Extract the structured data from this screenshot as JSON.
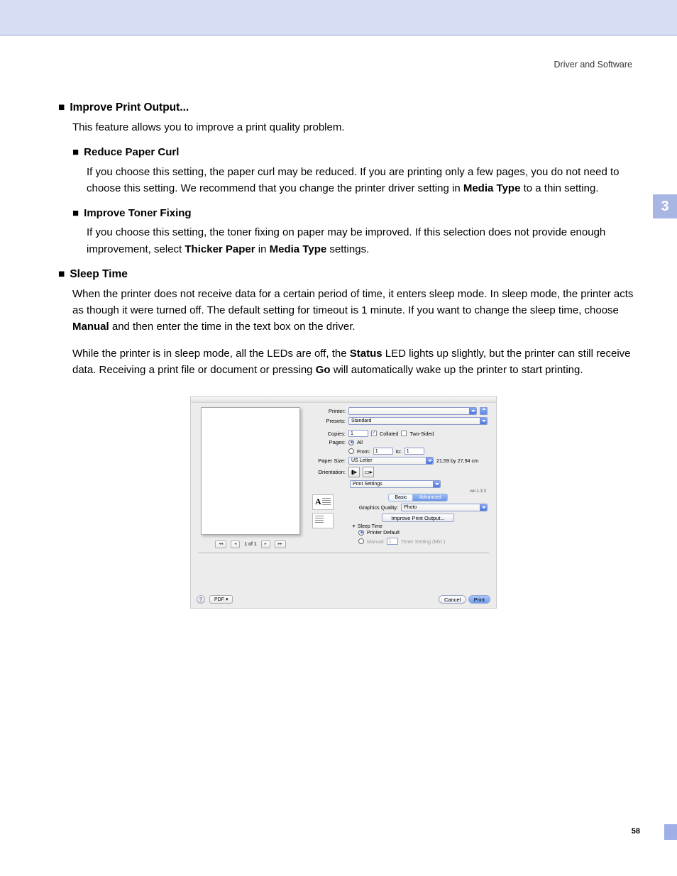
{
  "header": {
    "section": "Driver and Software"
  },
  "chapter": "3",
  "pageNumber": "58",
  "doc": {
    "s1_title": "Improve Print Output...",
    "s1_body": "This feature allows you to improve a print quality problem.",
    "s1a_title": "Reduce Paper Curl",
    "s1a_body_1": "If you choose this setting, the paper curl may be reduced. If you are printing only a few pages, you do not need to choose this setting. We recommend that you change the printer driver setting in ",
    "s1a_body_bold": "Media Type",
    "s1a_body_2": " to a thin setting.",
    "s1b_title": "Improve Toner Fixing",
    "s1b_body_1": "If you choose this setting, the toner fixing on paper may be improved. If this selection does not provide enough improvement, select ",
    "s1b_body_bold1": "Thicker Paper",
    "s1b_body_mid": " in ",
    "s1b_body_bold2": "Media Type",
    "s1b_body_2": " settings.",
    "s2_title": "Sleep Time",
    "s2_p1_1": "When the printer does not receive data for a certain period of time, it enters sleep mode. In sleep mode, the printer acts as though it were turned off. The default setting for timeout is 1 minute. If you want to change the sleep time, choose ",
    "s2_p1_bold": "Manual",
    "s2_p1_2": " and then enter the time in the text box on the driver.",
    "s2_p2_1": "While the printer is in sleep mode, all the LEDs are off, the ",
    "s2_p2_b1": "Status",
    "s2_p2_2": " LED lights up slightly, but the printer can still receive data. Receiving a print file or document or pressing ",
    "s2_p2_b2": "Go",
    "s2_p2_3": " will automatically wake up the printer to start printing."
  },
  "dialog": {
    "labels": {
      "printer": "Printer:",
      "presets": "Presets:",
      "copies": "Copies:",
      "collated": "Collated",
      "twoSided": "Two-Sided",
      "pages": "Pages:",
      "all": "All",
      "fromLabel": "From:",
      "toLabel": "to:",
      "paperSize": "Paper Size:",
      "paperDims": "21,59 by 27,94 cm",
      "orientation": "Orientation:",
      "printSettings": "Print Settings",
      "version": "ver.1.3.3",
      "basic": "Basic",
      "advanced": "Advanced",
      "graphicsQuality": "Graphics Quality:",
      "improveBtn": "Improve Print Output...",
      "sleepTime": "Sleep Time",
      "printerDefault": "Printer Default",
      "manual": "Manual",
      "timerSetting": "Timer Setting (Min.)"
    },
    "values": {
      "presets": "Standard",
      "copies": "1",
      "from": "1",
      "to": "1",
      "paperSize": "US Letter",
      "graphicsQuality": "Photo",
      "manualValue": "1"
    },
    "preview": {
      "page": "1 of 1",
      "navFirst": "◂◂",
      "navPrev": "◂",
      "navNext": "▸",
      "navLast": "▸▸"
    },
    "footer": {
      "help": "?",
      "pdf": "PDF ▾",
      "cancel": "Cancel",
      "print": "Print"
    }
  }
}
